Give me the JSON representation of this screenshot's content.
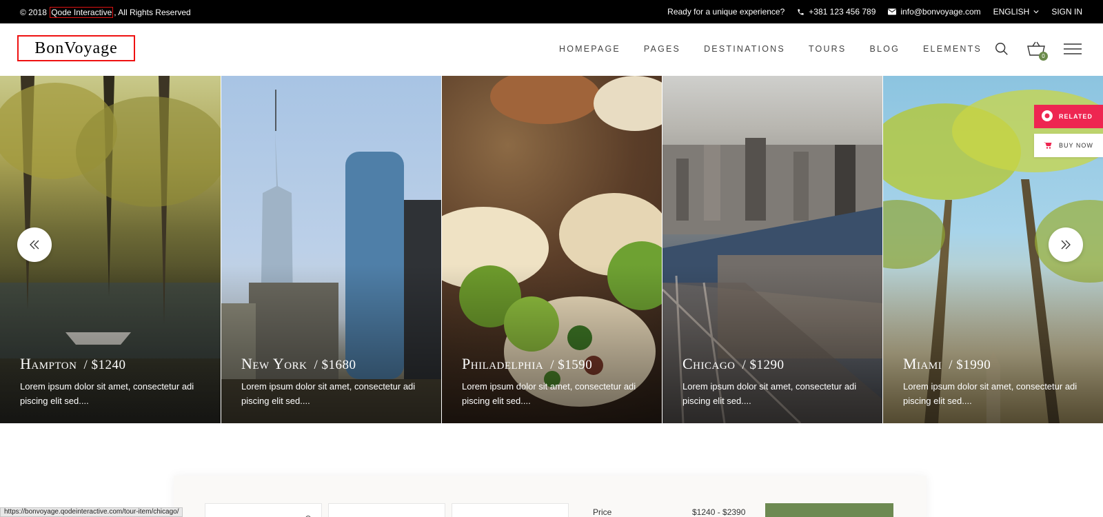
{
  "topbar": {
    "copyright_prefix": "© 2018",
    "copyright_link": "Qode Interactive",
    "copyright_suffix": ", All Rights Reserved",
    "tagline": "Ready for a unique experience?",
    "phone": "+381 123 456 789",
    "email": "info@bonvoyage.com",
    "language": "ENGLISH",
    "signin": "SIGN IN"
  },
  "header": {
    "logo": "BonVoyage",
    "nav": [
      "HOMEPAGE",
      "PAGES",
      "DESTINATIONS",
      "TOURS",
      "BLOG",
      "ELEMENTS"
    ],
    "cart_count": "0"
  },
  "slider": {
    "slides": [
      {
        "name": "Hampton",
        "price": "/ $1240",
        "desc": "Lorem ipsum dolor sit amet, consectetur adi piscing elit sed...."
      },
      {
        "name": "New York",
        "price": "/ $1680",
        "desc": "Lorem ipsum dolor sit amet, consectetur adi piscing elit sed...."
      },
      {
        "name": "Philadelphia",
        "price": "/ $1590",
        "desc": "Lorem ipsum dolor sit amet, consectetur adi piscing elit sed...."
      },
      {
        "name": "Chicago",
        "price": "/ $1290",
        "desc": "Lorem ipsum dolor sit amet, consectetur adi piscing elit sed...."
      },
      {
        "name": "Miami",
        "price": "/ $1990",
        "desc": "Lorem ipsum dolor sit amet, consectetur adi piscing elit sed...."
      }
    ]
  },
  "widgets": {
    "related": "RELATED",
    "buy_now": "BUY NOW"
  },
  "search": {
    "price_label": "Price",
    "price_range": "$1240 - $2390"
  },
  "statusbar": {
    "url": "https://bonvoyage.qodeinteractive.com/tour-item/chicago/"
  },
  "colors": {
    "accent_green": "#6d8a52",
    "related_red": "#ee2651"
  }
}
